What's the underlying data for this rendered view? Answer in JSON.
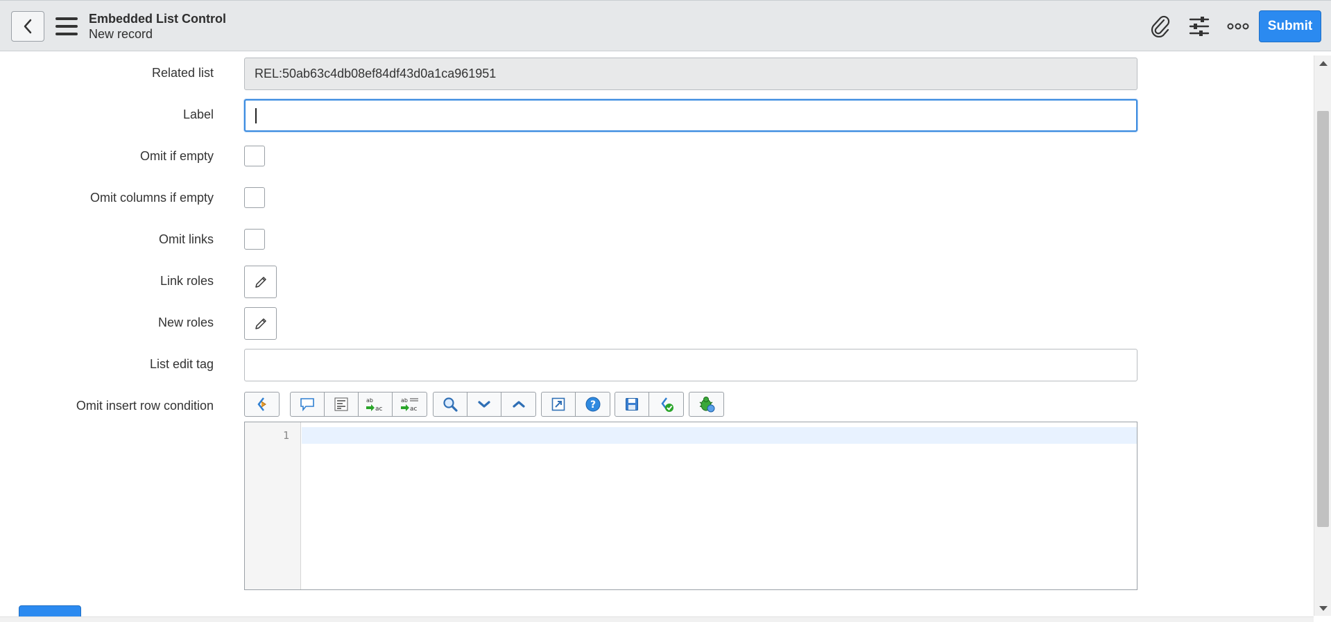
{
  "header": {
    "title": "Embedded List Control",
    "subtitle": "New record",
    "submit_label": "Submit"
  },
  "form": {
    "related_list": {
      "label": "Related list",
      "value": "REL:50ab63c4db08ef84df43d0a1ca961951"
    },
    "label": {
      "label": "Label",
      "value": ""
    },
    "omit_if_empty": {
      "label": "Omit if empty",
      "checked": false
    },
    "omit_columns_if_empty": {
      "label": "Omit columns if empty",
      "checked": false
    },
    "omit_links": {
      "label": "Omit links",
      "checked": false
    },
    "link_roles": {
      "label": "Link roles"
    },
    "new_roles": {
      "label": "New roles"
    },
    "list_edit_tag": {
      "label": "List edit tag",
      "value": ""
    },
    "omit_insert_row_condition": {
      "label": "Omit insert row condition",
      "line_number": "1"
    }
  },
  "icons": {
    "attachment": "paperclip-icon",
    "personalize": "sliders-icon",
    "more": "ellipsis-icon"
  }
}
